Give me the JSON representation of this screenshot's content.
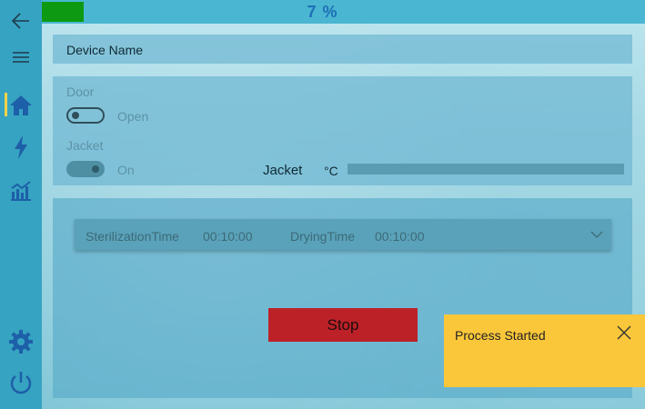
{
  "progress": {
    "percent_text": "7 %",
    "value": 0.07
  },
  "sidebar": {
    "back_icon": "arrow-left-icon",
    "menu_icon": "hamburger-icon",
    "items": [
      {
        "icon": "home-icon"
      },
      {
        "icon": "lightning-icon"
      },
      {
        "icon": "chart-icon"
      },
      {
        "icon": "gear-icon"
      },
      {
        "icon": "power-icon"
      }
    ]
  },
  "device": {
    "name_label": "Device Name"
  },
  "status": {
    "door_label": "Door",
    "door_state": "Open",
    "jacket_label": "Jacket",
    "jacket_state": "On",
    "jacket_temp_label": "Jacket",
    "temp_unit": "°C"
  },
  "program": {
    "sterilization_label": "SterilizationTime",
    "sterilization_value": "00:10:00",
    "drying_label": "DryingTime",
    "drying_value": "00:10:00"
  },
  "actions": {
    "stop_label": "Stop"
  },
  "toast": {
    "message": "Process Started"
  },
  "colors": {
    "accent": "#37a3c2",
    "progress": "#0d9a12",
    "stop": "#bd2128",
    "toast": "#fbc73a",
    "active": "#f4d24a"
  }
}
